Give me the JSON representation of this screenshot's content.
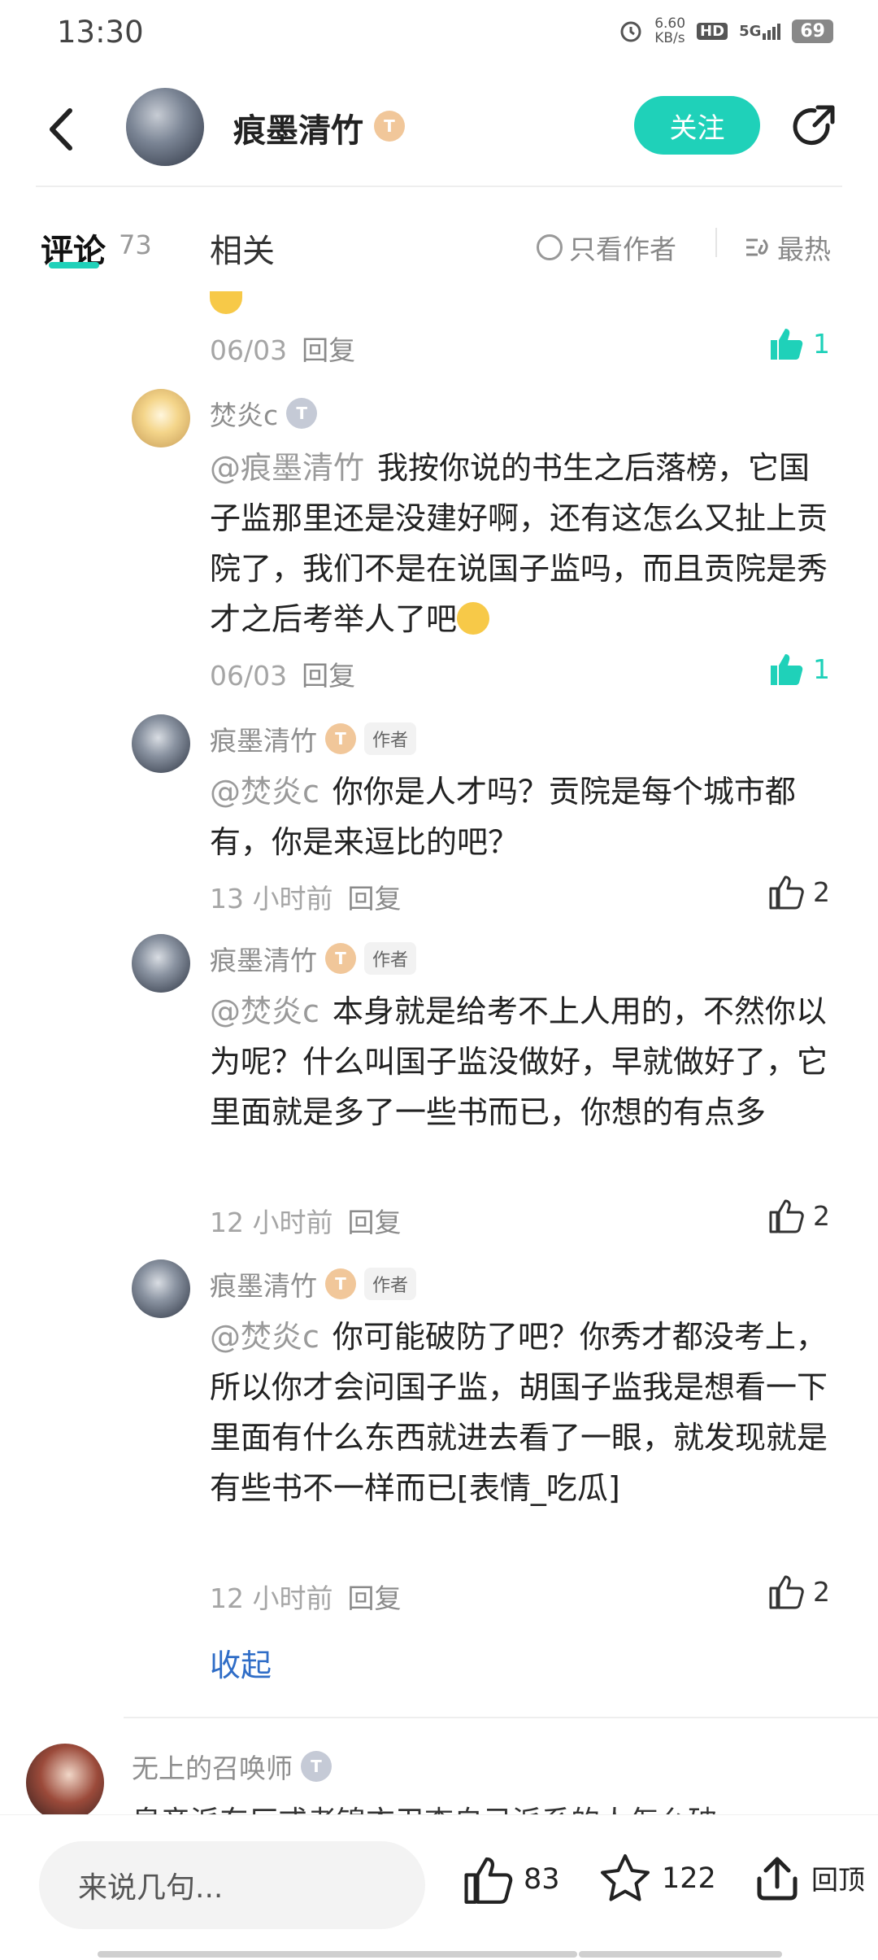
{
  "status_bar": {
    "time": "13:30",
    "net_speed": "6.60",
    "net_unit": "KB/s",
    "hd": "HD",
    "signal": "5G",
    "battery": "69"
  },
  "header": {
    "author_name": "痕墨清竹",
    "level_badge": "T",
    "follow_label": "关注"
  },
  "tabs": {
    "comments_label": "评论",
    "comments_count": "73",
    "related_label": "相关",
    "only_author_label": "只看作者",
    "sort_label": "最热"
  },
  "prev_comment": {
    "date": "06/03",
    "reply": "回复",
    "likes": "1"
  },
  "replies": [
    {
      "name": "焚炎c",
      "badge": "T",
      "mention": "@痕墨清竹",
      "text": "我按你说的书生之后落榜，它国子监那里还是没建好啊，还有这怎么又扯上贡院了，我们不是在说国子监吗，而且贡院是秀才之后考举人了吧",
      "time": "06/03",
      "reply": "回复",
      "likes": "1"
    },
    {
      "name": "痕墨清竹",
      "badge": "T",
      "tag": "作者",
      "mention": "@焚炎c",
      "text": "你你是人才吗？贡院是每个城市都有，你是来逗比的吧？",
      "time": "13 小时前",
      "reply": "回复",
      "likes": "2"
    },
    {
      "name": "痕墨清竹",
      "badge": "T",
      "tag": "作者",
      "mention": "@焚炎c",
      "text": "本身就是给考不上人用的，不然你以为呢？什么叫国子监没做好，早就做好了，它里面就是多了一些书而已，你想的有点多",
      "time": "12 小时前",
      "reply": "回复",
      "likes": "2"
    },
    {
      "name": "痕墨清竹",
      "badge": "T",
      "tag": "作者",
      "mention": "@焚炎c",
      "text": "你可能破防了吧？你秀才都没考上，所以你才会问国子监，胡国子监我是想看一下里面有什么东西就进去看了一眼，就发现就是有些书不一样而已[表情_吃瓜]",
      "time": "12 小时前",
      "reply": "回复",
      "likes": "2"
    }
  ],
  "collapse_label": "收起",
  "next_comment": {
    "name": "无上的召唤师",
    "badge": "T",
    "partial_text": "皇帝派东厂或者锦衣卫查自己派系的人怎么破"
  },
  "bottom_bar": {
    "input_placeholder": "来说几句...",
    "likes": "83",
    "favorites": "122",
    "top_label": "回顶"
  },
  "colors": {
    "accent": "#1fd1b9",
    "link": "#2f6dc7"
  },
  "icons": [
    "back-arrow-icon",
    "share-icon",
    "thumbs-up-icon",
    "star-icon",
    "upload-top-icon",
    "sort-fire-icon",
    "circle-icon"
  ]
}
